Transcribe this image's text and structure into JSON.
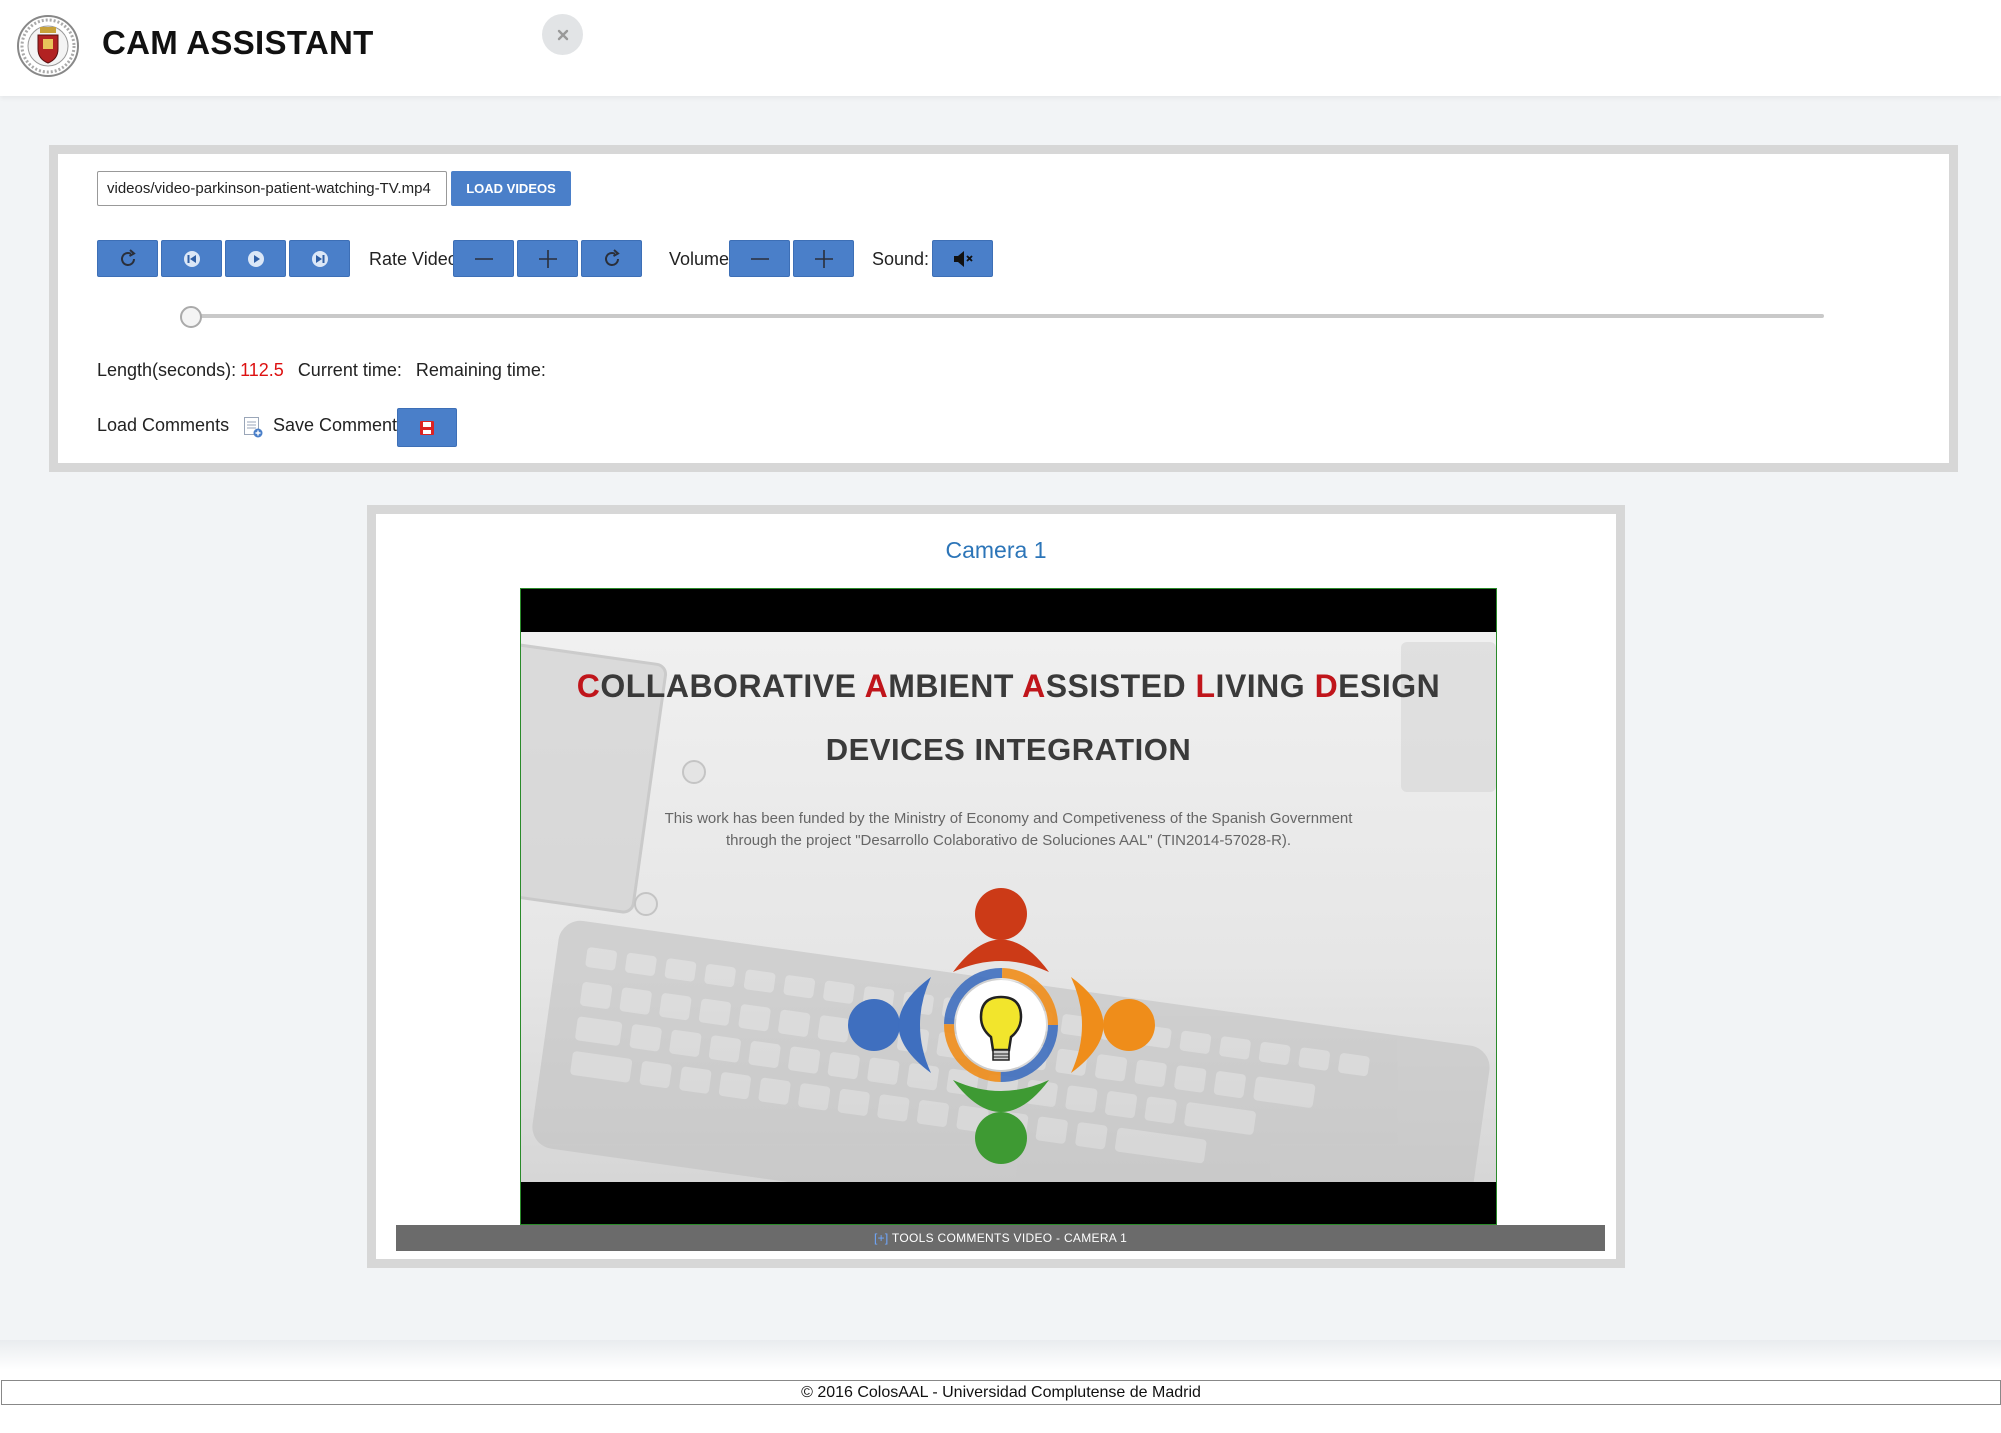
{
  "header": {
    "title": "CAM ASSISTANT"
  },
  "controls": {
    "video_path": "videos/video-parkinson-patient-watching-TV.mp4",
    "load_videos_label": "LOAD VIDEOS",
    "rate_video_label": "Rate Video:",
    "volume_label": "Volume:",
    "sound_label": "Sound:",
    "sound_state": "muted",
    "seek_position": 0
  },
  "info": {
    "length_label": "Length(seconds):",
    "length_value": "112.5",
    "current_time_label": "Current time:",
    "current_time_value": "",
    "remaining_time_label": "Remaining time:",
    "remaining_time_value": ""
  },
  "comments": {
    "load_label": "Load Comments",
    "save_label": "Save Comments"
  },
  "camera": {
    "title": "Camera 1",
    "video_frame": {
      "line1_parts": [
        "C",
        "OLLABORATIVE ",
        "A",
        "MBIENT ",
        "A",
        "SSISTED ",
        "L",
        "IVING ",
        "D",
        "ESIGN"
      ],
      "line2": "DEVICES INTEGRATION",
      "funding_line1": "This work has been funded by the Ministry of Economy and Competiveness of the Spanish Government",
      "funding_line2": "through the project \"Desarrollo Colaborativo de Soluciones AAL\" (TIN2014-57028-R)."
    },
    "tools_bar_prefix": "[+]",
    "tools_bar_label": " TOOLS COMMENTS VIDEO - CAMERA 1"
  },
  "footer": {
    "text": "© 2016 ColosAAL - Universidad Complutense de Madrid"
  },
  "colors": {
    "button_blue": "#4a7fc9",
    "title_blue": "#2c75b8",
    "accent_red": "#c0151b",
    "panel_border": "#d7d7d7"
  },
  "icons": [
    "university-seal-icon",
    "close-icon",
    "reload-icon",
    "skip-back-icon",
    "play-icon",
    "skip-forward-icon",
    "minus-icon",
    "plus-icon",
    "reset-icon",
    "mute-icon",
    "document-icon",
    "save-floppy-icon"
  ]
}
